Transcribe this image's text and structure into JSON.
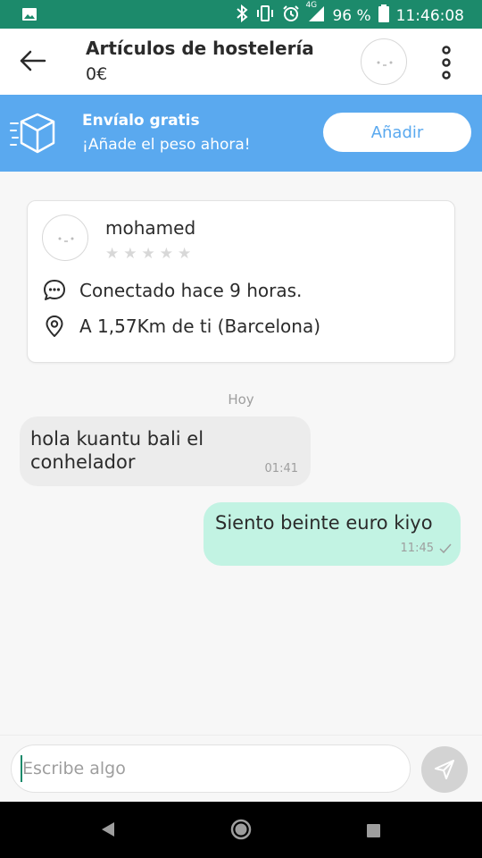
{
  "status_bar": {
    "battery_percent": "96 %",
    "time": "11:46:08",
    "network": "4G",
    "color": "#1c8a6b"
  },
  "header": {
    "title": "Artículos de hostelería",
    "price": "0€"
  },
  "banner": {
    "title": "Envíalo gratis",
    "subtitle": "¡Añade el peso ahora!",
    "button_label": "Añadir",
    "color": "#5aa9ef"
  },
  "profile": {
    "username": "mohamed",
    "rating_stars": 0,
    "max_stars": 5,
    "last_seen": "Conectado hace 9 horas.",
    "distance": "A 1,57Km de ti (Barcelona)"
  },
  "chat": {
    "date_label": "Hoy",
    "messages": [
      {
        "direction": "in",
        "text": "hola kuantu bali el conhelador",
        "time": "01:41"
      },
      {
        "direction": "out",
        "text": "Siento beinte euro kiyo",
        "time": "11:45",
        "status": "sent"
      }
    ]
  },
  "composer": {
    "placeholder": "Escribe algo"
  },
  "colors": {
    "accent": "#1c8a6b",
    "outgoing_bubble": "#c2f3e3",
    "incoming_bubble": "#ececec"
  }
}
